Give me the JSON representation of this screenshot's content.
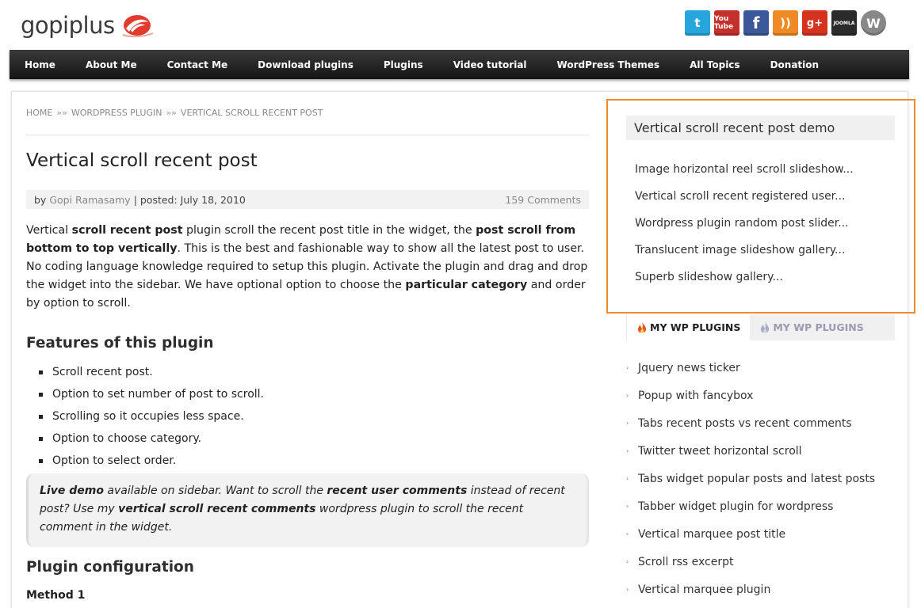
{
  "header": {
    "logo_text": "gopiplus",
    "social_icons": [
      {
        "name": "twitter-icon",
        "glyph": "t",
        "color": "#27a6dd"
      },
      {
        "name": "youtube-icon",
        "glyph": "You Tube",
        "color": "#c4302b"
      },
      {
        "name": "facebook-icon",
        "glyph": "f",
        "color": "#3b5998"
      },
      {
        "name": "rss-icon",
        "glyph": "))",
        "color": "#f08a24"
      },
      {
        "name": "google-plus-icon",
        "glyph": "g+",
        "color": "#d5321f"
      },
      {
        "name": "joomla-icon",
        "glyph": "JOOMLA",
        "color": "#2b2b2b"
      },
      {
        "name": "wordpress-icon",
        "glyph": "W",
        "color": "#888888"
      }
    ]
  },
  "nav": {
    "items": [
      "Home",
      "About Me",
      "Contact Me",
      "Download plugins",
      "Plugins",
      "Video tutorial",
      "WordPress Themes",
      "All Topics",
      "Donation"
    ]
  },
  "breadcrumb": {
    "home": "HOME",
    "sep": "»»",
    "section": "WORDPRESS PLUGIN",
    "current": "VERTICAL SCROLL RECENT POST"
  },
  "post": {
    "title": "Vertical scroll recent post",
    "meta": {
      "by": "by",
      "author": "Gopi Ramasamy",
      "posted": "| posted: July 18, 2010",
      "comments": "159 Comments"
    },
    "intro": {
      "p1": "Vertical ",
      "b1": "scroll recent post",
      "p2": " plugin scroll the recent post title in the widget, the ",
      "b2": "post scroll from bottom to top vertically",
      "p3": ". This is the best and fashionable way to show all the latest post to user. No coding language knowledge required to setup this plugin. Activate the plugin and drag and drop the widget into the sidebar. We have optional option to choose the ",
      "b3": "particular category",
      "p4": " and order by option to scroll."
    },
    "features_heading": "Features of this plugin",
    "features": [
      "Scroll recent post.",
      "Option to set number of post to scroll.",
      "Scrolling so it occupies less space.",
      "Option to choose category.",
      "Option to select order."
    ],
    "note": {
      "b1": "Live demo",
      "t1": " available on sidebar. Want to scroll the ",
      "b2": "recent user comments",
      "t2": " instead of recent post? Use my ",
      "b3": "vertical scroll recent comments",
      "t3": " wordpress plugin to scroll the recent comment in the widget."
    },
    "config_heading": "Plugin configuration",
    "method": "Method 1"
  },
  "sidebar": {
    "demo_title": "Vertical scroll recent post demo",
    "demo_items": [
      "Image horizontal reel scroll slideshow...",
      "Vertical scroll recent registered user...",
      "Wordpress plugin random post slider...",
      "Translucent image slideshow gallery...",
      "Superb slideshow gallery..."
    ],
    "tabs": [
      "MY WP PLUGINS",
      "MY WP PLUGINS"
    ],
    "plugins": [
      "Jquery news ticker",
      "Popup with fancybox",
      "Tabs recent posts vs recent comments",
      "Twitter tweet horizontal scroll",
      "Tabs widget popular posts and latest posts",
      "Tabber widget plugin for wordpress",
      "Vertical marquee post title",
      "Scroll rss excerpt",
      "Vertical marquee plugin"
    ],
    "accent_color": "#f08a2c"
  }
}
